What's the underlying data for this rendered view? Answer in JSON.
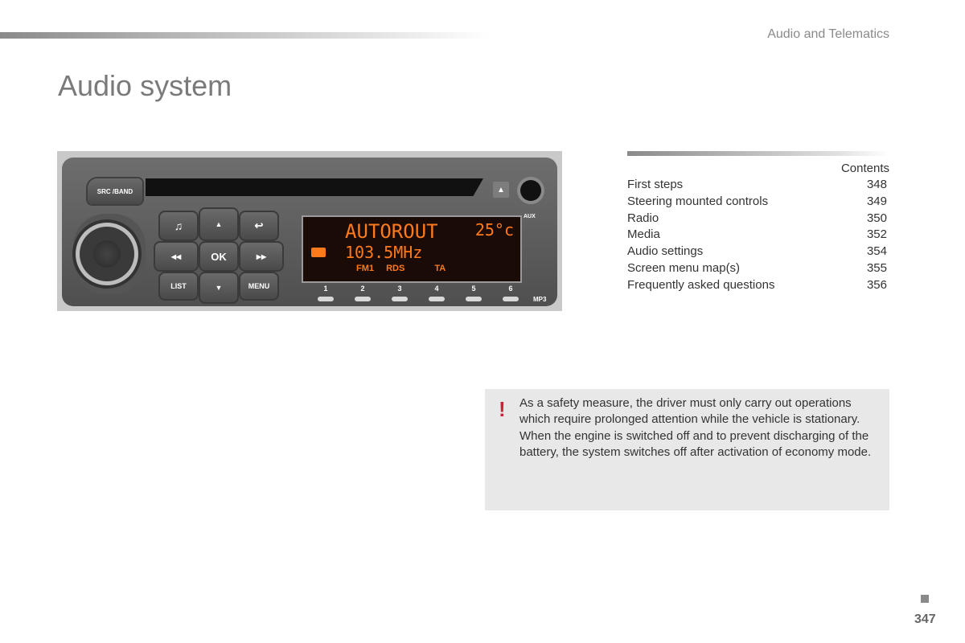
{
  "header": {
    "section_title": "Audio and Telematics",
    "page_title": "Audio system"
  },
  "radio": {
    "src_band_label": "SRC /BAND",
    "eject_glyph": "▲",
    "aux_label": "AUX",
    "mp3_label": "MP3",
    "buttons": {
      "music_glyph": "♫",
      "up_glyph": "▲",
      "back_glyph": "↩",
      "rewind_glyph": "◀◀",
      "ok_label": "OK",
      "forward_glyph": "▶▶",
      "list_label": "LIST",
      "down_glyph": "▼",
      "menu_label": "MENU"
    },
    "display": {
      "station_name": "AUTOROUT",
      "temperature": "25°c",
      "frequency": "103.5MHz",
      "indicators": [
        "FM1",
        "RDS",
        "TA"
      ]
    },
    "presets": [
      "1",
      "2",
      "3",
      "4",
      "5",
      "6"
    ]
  },
  "contents": {
    "heading": "Contents",
    "items": [
      {
        "label": "First steps",
        "page": "348"
      },
      {
        "label": "Steering mounted controls",
        "page": "349"
      },
      {
        "label": "Radio",
        "page": "350"
      },
      {
        "label": "Media",
        "page": "352"
      },
      {
        "label": "Audio settings",
        "page": "354"
      },
      {
        "label": "Screen menu map(s)",
        "page": "355"
      },
      {
        "label": "Frequently asked questions",
        "page": "356"
      }
    ]
  },
  "warning": {
    "icon": "!",
    "text": "As a safety measure, the driver must only carry out operations which require prolonged attention while the vehicle is stationary. When the engine is switched off and to prevent discharging of the battery, the system switches off after activation of economy mode."
  },
  "footer": {
    "page_number": "347"
  }
}
